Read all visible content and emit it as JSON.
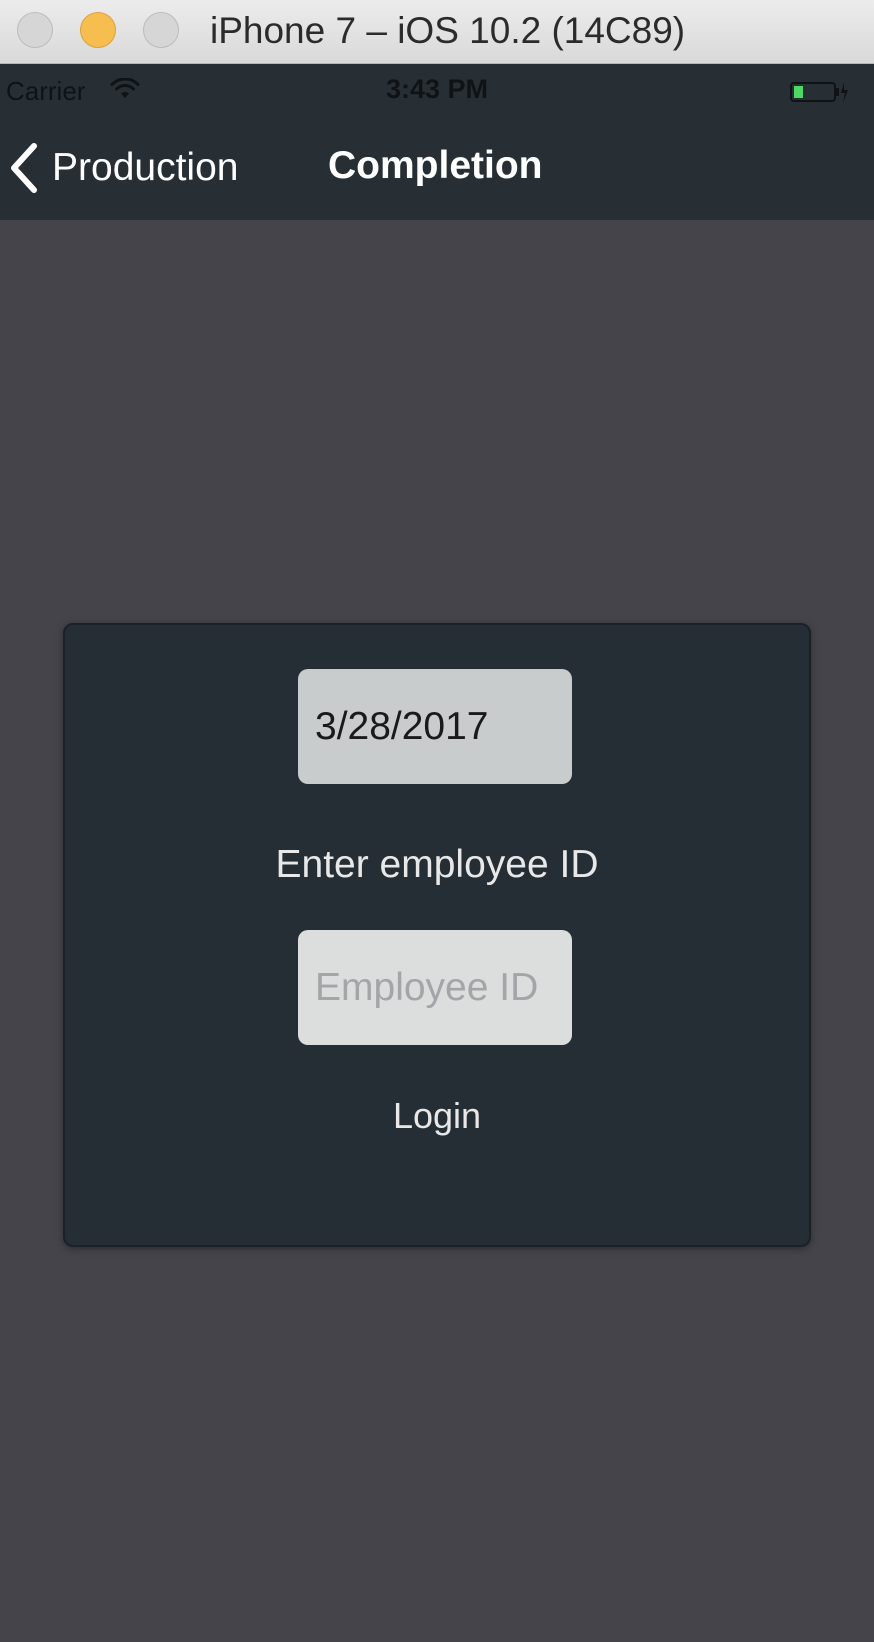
{
  "window": {
    "title": "iPhone 7 – iOS 10.2 (14C89)"
  },
  "status_bar": {
    "carrier": "Carrier",
    "time": "3:43 PM",
    "icons": [
      "wifi-icon",
      "battery-icon"
    ],
    "battery_color": "#4cd964"
  },
  "nav_bar": {
    "back_label": "Production",
    "title": "Completion",
    "back_icon": "chevron-left-icon"
  },
  "form": {
    "date_value": "3/28/2017",
    "prompt": "Enter employee ID",
    "employee_id_value": "",
    "employee_id_placeholder": "Employee ID",
    "login_label": "Login"
  },
  "colors": {
    "background": "#45444b",
    "bar": "#272f35",
    "card": "#262e35",
    "field": "#c9cccd"
  }
}
